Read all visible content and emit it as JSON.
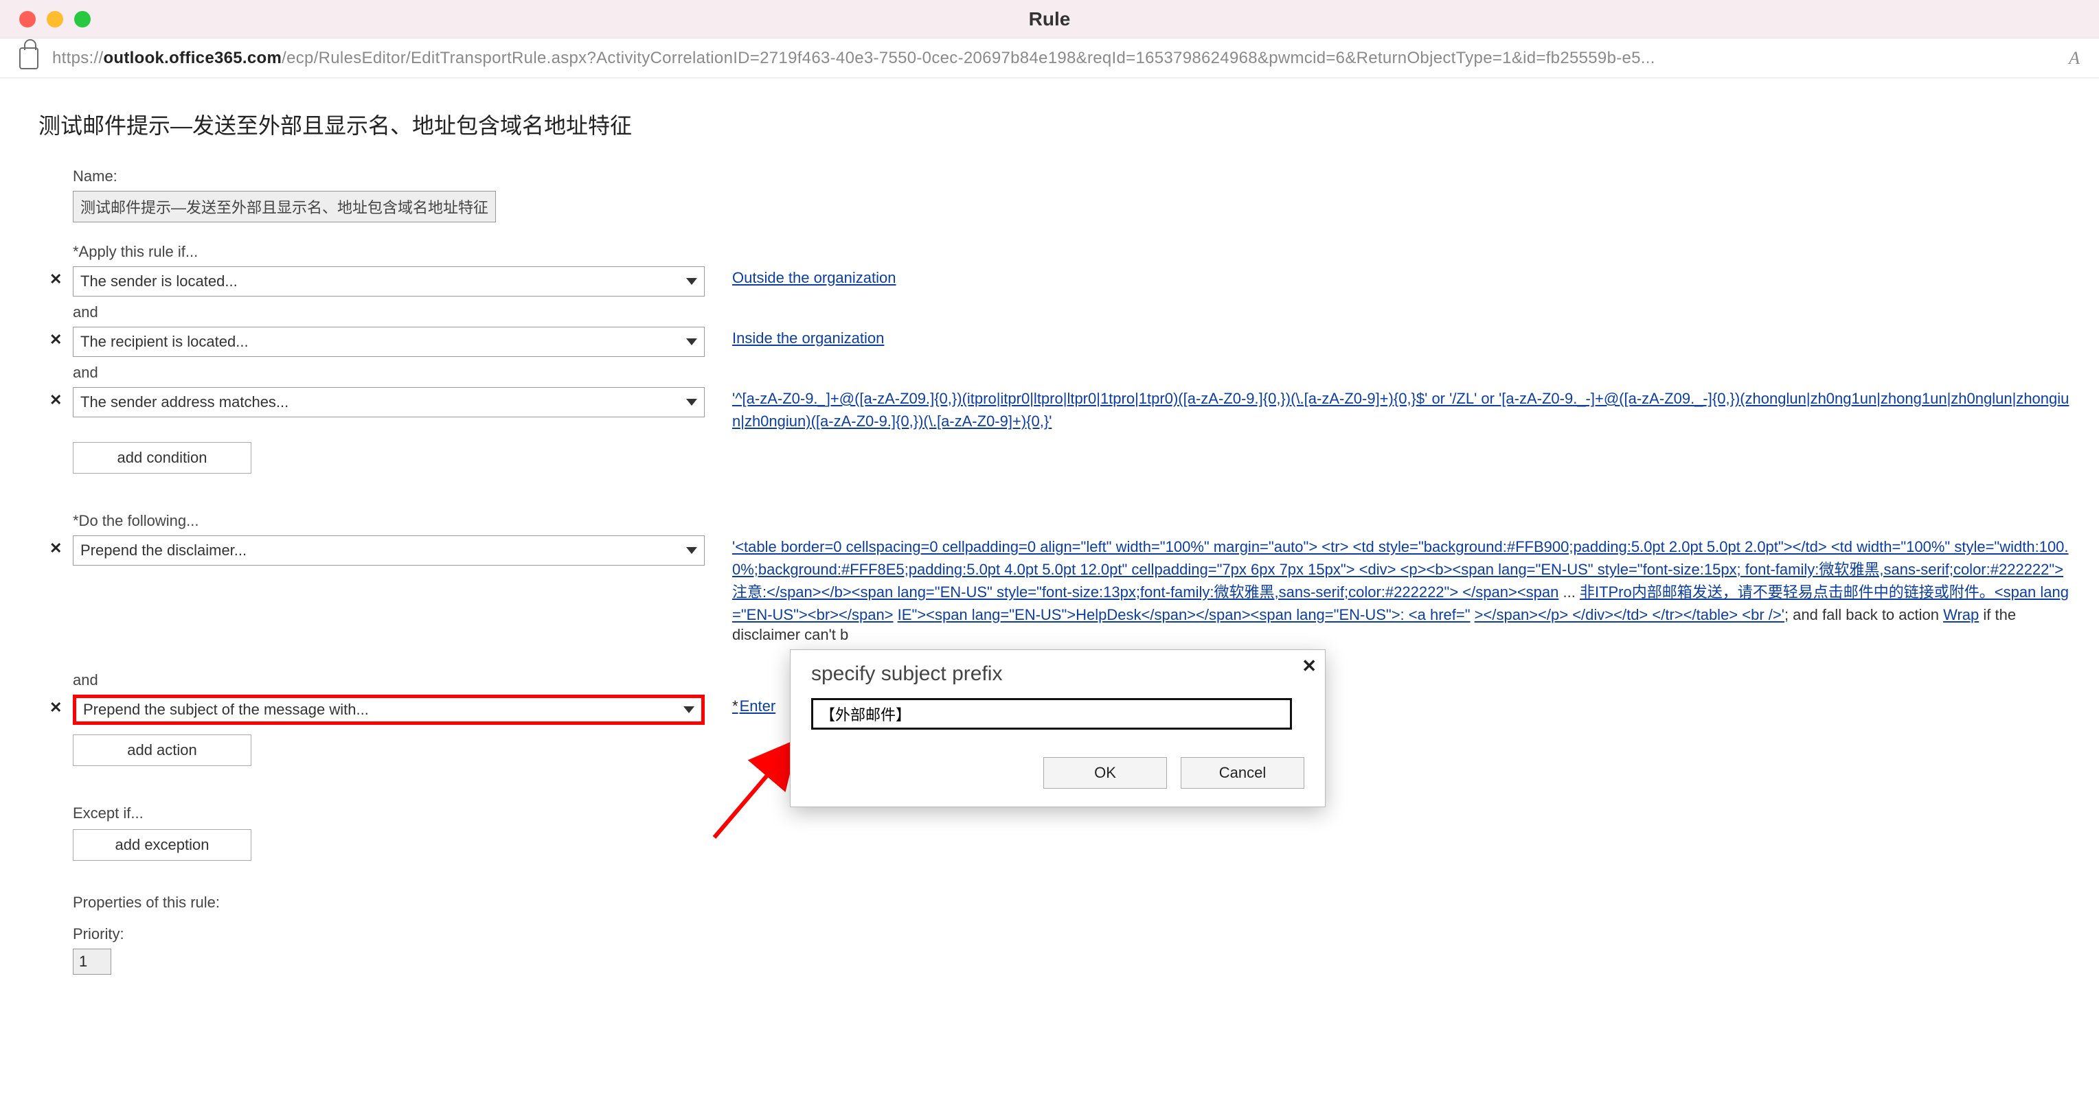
{
  "window": {
    "title": "Rule"
  },
  "url": {
    "schema": "https://",
    "host": "outlook.office365.com",
    "path": "/ecp/RulesEditor/EditTransportRule.aspx?ActivityCorrelationID=2719f463-40e3-7550-0cec-20697b84e198&reqId=1653798624968&pwmcid=6&ReturnObjectType=1&id=fb25559b-e5...",
    "aa": "A"
  },
  "page": {
    "title": "测试邮件提示—发送至外部且显示名、地址包含域名地址特征",
    "name_label": "Name:",
    "name_value": "测试邮件提示—发送至外部且显示名、地址包含域名地址特征",
    "apply_label": "*Apply this rule if...",
    "conditions": [
      {
        "select": "The sender is located...",
        "right_link": "Outside the organization"
      },
      {
        "select": "The recipient is located...",
        "right_link": "Inside the organization"
      },
      {
        "select": "The sender address matches...",
        "right_link": "'^[a-zA-Z0-9._]+@([a-zA-Z09.]{0,})(itpro|itpr0|ltpro|ltpr0|1tpro|1tpr0)([a-zA-Z0-9.]{0,})(\\.[a-zA-Z0-9]+){0,}$' or '/ZL' or '[a-zA-Z0-9._-]+@([a-zA-Z09._-]{0,})(zhonglun|zh0ng1un|zhong1un|zh0nglun|zhongiun|zh0ngiun)([a-zA-Z0-9.]{0,})(\\.[a-zA-Z0-9]+){0,}'"
      }
    ],
    "and": "and",
    "add_condition": "add condition",
    "do_label": "*Do the following...",
    "actions": [
      {
        "select": "Prepend the disclaimer...",
        "right_html_pre": "'<table border=0 cellspacing=0 cellpadding=0 align=\"left\" width=\"100%\" margin=\"auto\"> <tr> <td style=\"background:#FFB900;padding:5.0pt 2.0pt 5.0pt 2.0pt\"></td> <td width=\"100%\" style=\"width:100.0%;background:#FFF8E5;padding:5.0pt 4.0pt 5.0pt 12.0pt\" cellpadding=\"7px 6px 7px 15px\"> <div> <p><b><span lang=\"EN-US\" style=\"font-size:15px; font-family:微软雅黑,sans-serif;color:#222222\">注意:</span></b><span lang=\"EN-US\" style=\"font-size:13px;font-family:微软雅黑,sans-serif;color:#222222\"> </span><span",
        "right_gap1": "非ITPro内部邮箱发送，请不要轻易点击邮件中的链接或附件。<span lang=\"EN-US\"><br></span>",
        "right_gap2": "IE\"><span lang=\"EN-US\">HelpDesk</span></span><span lang=\"EN-US\">: <a href=\"",
        "right_gap3": "></span></p> </div></td> </tr></table> <br />'",
        "right_trail": "; and fall back to action ",
        "right_wrap": "Wrap",
        "right_trail2": " if the disclaimer can't b"
      },
      {
        "select": "Prepend the subject of the message with...",
        "highlight": true,
        "right_link_req": "Enter"
      }
    ],
    "add_action": "add action",
    "except_label": "Except if...",
    "add_exception": "add exception",
    "props_label": "Properties of this rule:",
    "priority_label": "Priority:",
    "priority_value": "1"
  },
  "dialog": {
    "title": "specify subject prefix",
    "value": "【外部邮件】",
    "ok": "OK",
    "cancel": "Cancel"
  }
}
